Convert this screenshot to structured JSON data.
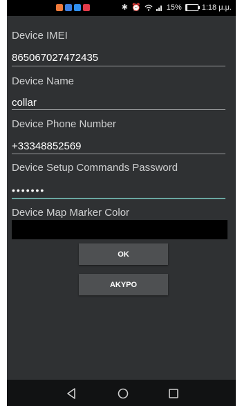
{
  "status_bar": {
    "notification_icons": [
      {
        "name": "orange-app-icon",
        "color": "#f07a3a"
      },
      {
        "name": "blue-app-icon",
        "color": "#3d7fe0"
      },
      {
        "name": "blue-messenger-icon",
        "color": "#2f8ff0"
      },
      {
        "name": "red-app-icon",
        "color": "#e23b4a"
      }
    ],
    "battery_text": "15%",
    "battery_level": 0.15,
    "time": "1:18 μ.μ."
  },
  "form": {
    "imei_label": "Device IMEI",
    "imei_value": "865067027472435",
    "name_label": "Device Name",
    "name_value": "collar",
    "phone_label": "Device Phone Number",
    "phone_value": "+33348852569",
    "password_label": "Device Setup Commands Password",
    "password_value": "•••••••",
    "color_label": "Device Map Marker Color",
    "marker_color": "#000000"
  },
  "buttons": {
    "ok_label": "OK",
    "cancel_label": "ΑΚΥΡΟ"
  },
  "colors": {
    "background": "#2f3133",
    "accent": "#6aa6a0"
  },
  "nav": {
    "back": "back-icon",
    "home": "home-icon",
    "recents": "recents-icon"
  }
}
